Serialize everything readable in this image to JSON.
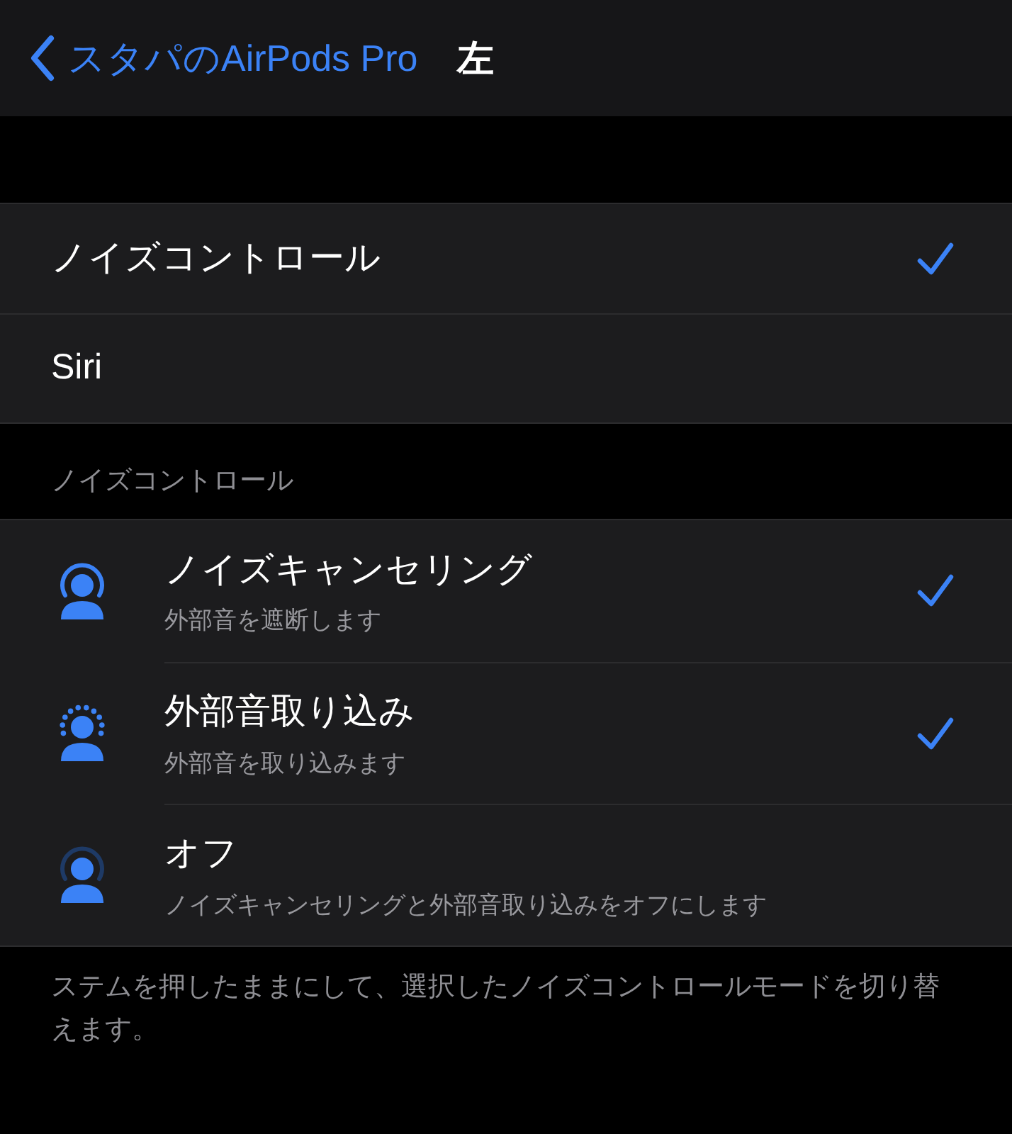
{
  "nav": {
    "back_label": "スタパのAirPods Pro",
    "title": "左"
  },
  "press_and_hold": [
    {
      "label": "ノイズコントロール",
      "selected": true
    },
    {
      "label": "Siri",
      "selected": false
    }
  ],
  "noise_control": {
    "header": "ノイズコントロール",
    "modes": [
      {
        "kind": "cancel",
        "label": "ノイズキャンセリング",
        "detail": "外部音を遮断します",
        "selected": true
      },
      {
        "kind": "transparency",
        "label": "外部音取り込み",
        "detail": "外部音を取り込みます",
        "selected": true
      },
      {
        "kind": "off",
        "label": "オフ",
        "detail": "ノイズキャンセリングと外部音取り込みをオフにします",
        "selected": false
      }
    ],
    "footer": "ステムを押したままにして、選択したノイズコントロールモードを切り替えます。"
  }
}
